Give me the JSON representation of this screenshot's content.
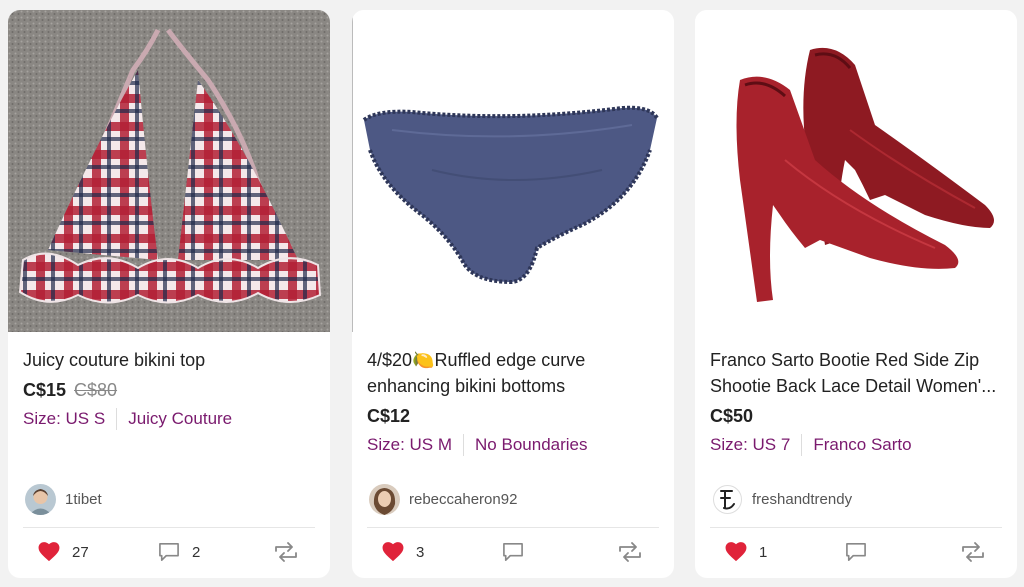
{
  "listings": [
    {
      "title": "Juicy couture bikini top",
      "price": "C$15",
      "original_price": "C$80",
      "size": "Size: US S",
      "brand": "Juicy Couture",
      "seller": "1tibet",
      "likes": "27",
      "comments": "2"
    },
    {
      "title": "4/$20🍋Ruffled edge curve enhancing bikini bottoms",
      "price": "C$12",
      "original_price": "",
      "size": "Size: US M",
      "brand": "No Boundaries",
      "seller": "rebeccaheron92",
      "likes": "3",
      "comments": ""
    },
    {
      "title": "Franco Sarto Bootie Red Side Zip Shootie Back Lace Detail Women'...",
      "price": "C$50",
      "original_price": "",
      "size": "Size: US 7",
      "brand": "Franco Sarto",
      "seller": "freshandtrendy",
      "likes": "1",
      "comments": ""
    }
  ],
  "colors": {
    "accent": "#7a1a6e",
    "like": "#e0233a",
    "icon": "#888888"
  }
}
